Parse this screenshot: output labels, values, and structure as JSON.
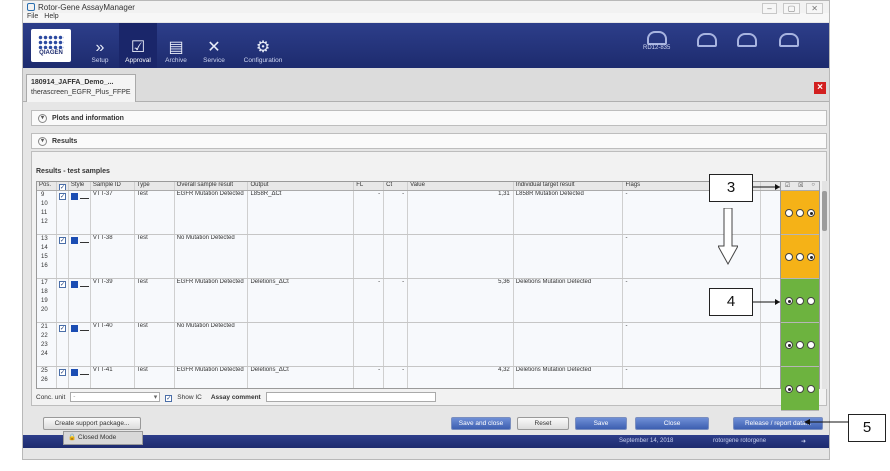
{
  "window": {
    "title": "Rotor-Gene AssayManager",
    "menu": [
      "File",
      "Help"
    ]
  },
  "toolbar": {
    "brand": "QIAGEN",
    "items": [
      {
        "label": "Setup",
        "icon": "chevrons-icon"
      },
      {
        "label": "Approval",
        "icon": "checkmark-icon"
      },
      {
        "label": "Archive",
        "icon": "archive-icon"
      },
      {
        "label": "Service",
        "icon": "tools-icon"
      },
      {
        "label": "Configuration",
        "icon": "gears-icon"
      }
    ],
    "instrument_label": "RD12-835"
  },
  "experiment_tab": {
    "line1": "180914_JAFFA_Demo_...",
    "line2": "therascreen_EGFR_Plus_FFPE"
  },
  "sections": {
    "plots": "Plots and information",
    "results": "Results"
  },
  "results": {
    "title": "Results - test samples",
    "columns": [
      "Pos.",
      "",
      "Style",
      "Sample ID",
      "Type",
      "Overall sample result",
      "Output",
      "FL",
      "Ct",
      "Value",
      "Individual target result",
      "Flags"
    ],
    "rows": [
      {
        "positions": [
          "9",
          "10",
          "11",
          "12"
        ],
        "sample_id": "VTT-37",
        "type": "Test",
        "overall": "EGFR Mutation Detected",
        "output": "L858R_ΔCt",
        "fl": "-",
        "ct": "-",
        "value": "1,31",
        "target": "L858R Mutation Detected",
        "flags": "-"
      },
      {
        "positions": [
          "13",
          "14",
          "15",
          "16"
        ],
        "sample_id": "VTT-38",
        "type": "Test",
        "overall": "No Mutation Detected",
        "output": "",
        "fl": "",
        "ct": "",
        "value": "",
        "target": "",
        "flags": "-"
      },
      {
        "positions": [
          "17",
          "18",
          "19",
          "20"
        ],
        "sample_id": "VTT-39",
        "type": "Test",
        "overall": "EGFR Mutation Detected",
        "output": "Deletions_ΔCt",
        "fl": "-",
        "ct": "-",
        "value": "5,36",
        "target": "Deletions Mutation Detected",
        "flags": "-"
      },
      {
        "positions": [
          "21",
          "22",
          "23",
          "24"
        ],
        "sample_id": "VTT-40",
        "type": "Test",
        "overall": "No Mutation Detected",
        "output": "",
        "fl": "",
        "ct": "",
        "value": "",
        "target": "",
        "flags": "-"
      },
      {
        "positions": [
          "25",
          "26"
        ],
        "sample_id": "VTT-41",
        "type": "Test",
        "overall": "EGFR Mutation Detected",
        "output": "Deletions_ΔCt",
        "fl": "-",
        "ct": "-",
        "value": "4,32",
        "target": "Deletions Mutation Detected",
        "flags": "-"
      }
    ],
    "approval_colors": {
      "pending": "#f5b217",
      "accepted": "#6db33f"
    },
    "conc_unit_label": "Conc. unit",
    "conc_unit_value": "-",
    "show_ic": "Show IC",
    "assay_comment": "Assay comment"
  },
  "buttons": {
    "support": "Create support package...",
    "save_close": "Save and close",
    "reset": "Reset",
    "save": "Save",
    "close": "Close",
    "release": "Release / report data..."
  },
  "status": {
    "mode": "Closed Mode",
    "date": "September 14, 2018",
    "user": "rotorgene rotorgene"
  },
  "callouts": [
    "3",
    "4",
    "5"
  ]
}
